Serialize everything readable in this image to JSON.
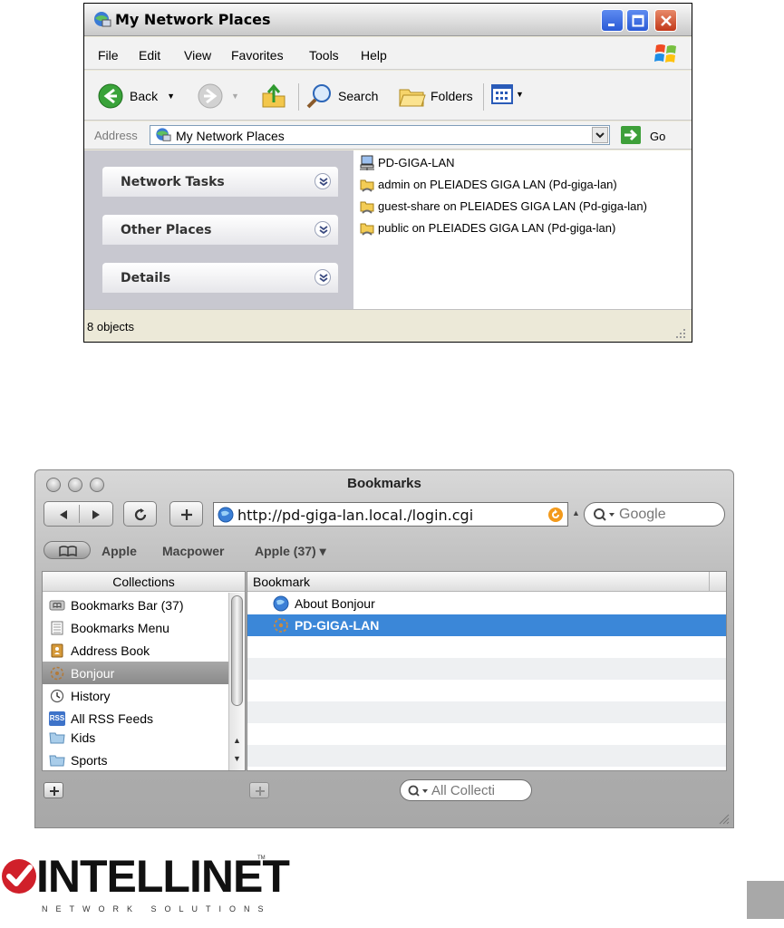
{
  "xp_window": {
    "title": "My Network Places",
    "menus": [
      "File",
      "Edit",
      "View",
      "Favorites",
      "Tools",
      "Help"
    ],
    "toolbar": {
      "back_label": "Back",
      "search_label": "Search",
      "folders_label": "Folders"
    },
    "address": {
      "label": "Address",
      "value": "My Network Places",
      "go_label": "Go"
    },
    "tasks": [
      {
        "title": "Network Tasks"
      },
      {
        "title": "Other Places"
      },
      {
        "title": "Details"
      }
    ],
    "items": [
      {
        "icon": "network-computer-icon",
        "label": "PD-GIGA-LAN"
      },
      {
        "icon": "network-share-icon",
        "label": "admin on PLEIADES GIGA LAN (Pd-giga-lan)"
      },
      {
        "icon": "network-share-icon",
        "label": "guest-share on PLEIADES GIGA LAN (Pd-giga-lan)"
      },
      {
        "icon": "network-share-icon",
        "label": "public on PLEIADES GIGA LAN (Pd-giga-lan)"
      }
    ],
    "status": "8 objects"
  },
  "mac_window": {
    "title": "Bookmarks",
    "url": "http://pd-giga-lan.local./login.cgi",
    "search_placeholder": "Google",
    "bookmarks_bar": [
      "Apple",
      "Macpower",
      "Apple (37) ▾"
    ],
    "collections_header": "Collections",
    "collections": [
      {
        "icon": "bookmarks-bar-icon",
        "label": "Bookmarks Bar (37)"
      },
      {
        "icon": "bookmarks-menu-icon",
        "label": "Bookmarks Menu"
      },
      {
        "icon": "address-book-icon",
        "label": "Address Book"
      },
      {
        "icon": "bonjour-icon",
        "label": "Bonjour",
        "selected": true
      },
      {
        "icon": "history-icon",
        "label": "History"
      },
      {
        "icon": "rss-icon",
        "label": "All RSS Feeds"
      },
      {
        "icon": "folder-icon",
        "label": "Kids"
      },
      {
        "icon": "folder-icon",
        "label": "Sports"
      }
    ],
    "bookmark_header": "Bookmark",
    "bookmarks": [
      {
        "icon": "globe-icon",
        "label": "About Bonjour"
      },
      {
        "icon": "bonjour-icon",
        "label": "PD-GIGA-LAN",
        "selected": true
      }
    ],
    "filter_placeholder": "All Collecti",
    "rss_badge": "RSS"
  },
  "footer": {
    "logo_text": "INTELLINET",
    "logo_tagline": "NETWORK SOLUTIONS",
    "logo_tm": "TM"
  },
  "colors": {
    "xp_go_green": "#3ea03a",
    "mac_selection_blue": "#3b87d8",
    "logo_red": "#d0202a"
  }
}
